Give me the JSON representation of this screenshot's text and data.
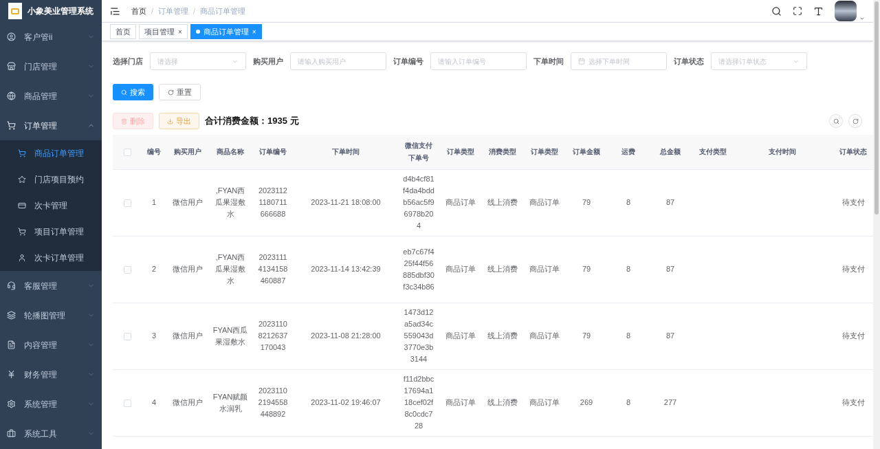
{
  "app": {
    "title": "小象美业管理系统"
  },
  "sidebar": {
    "items": [
      {
        "label": "客户管ii",
        "expanded": false
      },
      {
        "label": "门店管理",
        "expanded": false
      },
      {
        "label": "商品管理",
        "expanded": false
      },
      {
        "label": "订单管理",
        "expanded": true,
        "children": [
          {
            "label": "商品订单管理",
            "selected": true
          },
          {
            "label": "门店项目预约",
            "selected": false
          },
          {
            "label": "次卡管理",
            "selected": false
          },
          {
            "label": "项目订单管理",
            "selected": false
          },
          {
            "label": "次卡订单管理",
            "selected": false
          }
        ]
      },
      {
        "label": "客服管理",
        "expanded": false
      },
      {
        "label": "轮播图管理",
        "expanded": false
      },
      {
        "label": "内容管理",
        "expanded": false
      },
      {
        "label": "财务管理",
        "expanded": false
      },
      {
        "label": "系统管理",
        "expanded": false
      },
      {
        "label": "系统工具",
        "expanded": false
      }
    ]
  },
  "breadcrumb": [
    "首页",
    "订单管理",
    "商品订单管理"
  ],
  "breadcrumb_separator": "/",
  "tabs": [
    {
      "label": "首页",
      "closable": false,
      "selected": false
    },
    {
      "label": "项目管理",
      "closable": true,
      "selected": false
    },
    {
      "label": "商品订单管理",
      "closable": true,
      "selected": true
    }
  ],
  "tab_close": "×",
  "filters": [
    {
      "label": "选择门店",
      "kind": "select",
      "placeholder": "请选择"
    },
    {
      "label": "购买用户",
      "kind": "input",
      "placeholder": "请输入购买用户"
    },
    {
      "label": "订单编号",
      "kind": "input",
      "placeholder": "请输入订单编号"
    },
    {
      "label": "下单时间",
      "kind": "date",
      "placeholder": "选择下单时间"
    },
    {
      "label": "订单状态",
      "kind": "select",
      "placeholder": "请选择订单状态"
    }
  ],
  "search_button": "搜索",
  "reset_button": "重置",
  "delete_button": {
    "label": "删除",
    "disabled": true
  },
  "export_button": "导出",
  "total": "合计消费金额：1935 元",
  "table": {
    "select_all_checked": false,
    "columns": [
      "编号",
      "购买用户",
      "商品名称",
      "订单编号",
      "下单时间",
      "微信支付下单号",
      "订单类型",
      "消费类型",
      "订单类型",
      "订单金额",
      "运费",
      "总金额",
      "支付类型",
      "支付时间",
      "订单状态"
    ],
    "rows": [
      {
        "checked": false,
        "cells": [
          "1",
          "微信用户",
          ",FYAN西瓜果湿敷水",
          "20231121180711666688",
          "2023-11-21 18:08:00",
          "d4b4cf81f4da4bddb56ac5f96978b204",
          "商品订单",
          "线上消费",
          "商品订单",
          "79",
          "8",
          "87",
          "",
          "",
          "待支付"
        ]
      },
      {
        "checked": false,
        "cells": [
          "2",
          "微信用户",
          ",FYAN西瓜果湿敷水",
          "20231114134158460887",
          "2023-11-14 13:42:39",
          "eb7c67f425f44f56885dbf30f3c34b86",
          "商品订单",
          "线上消费",
          "商品订单",
          "79",
          "8",
          "87",
          "",
          "",
          "待支付"
        ]
      },
      {
        "checked": false,
        "cells": [
          "3",
          "微信用户",
          "FYAN西瓜果湿敷水",
          "20231108212637170043",
          "2023-11-08 21:28:00",
          "1473d12a5ad34c559043d3770e3b3144",
          "商品订单",
          "线上消费",
          "商品订单",
          "79",
          "8",
          "87",
          "",
          "",
          "待支付"
        ]
      },
      {
        "checked": false,
        "cells": [
          "4",
          "微信用户",
          "FYAN赋颜水润乳",
          "20231102194558448892",
          "2023-11-02 19:46:07",
          "f11d2bbc17694a118cef02f8c0cdc728",
          "商品订单",
          "线上消费",
          "商品订单",
          "269",
          "8",
          "277",
          "",
          "",
          "待支付"
        ]
      }
    ]
  }
}
